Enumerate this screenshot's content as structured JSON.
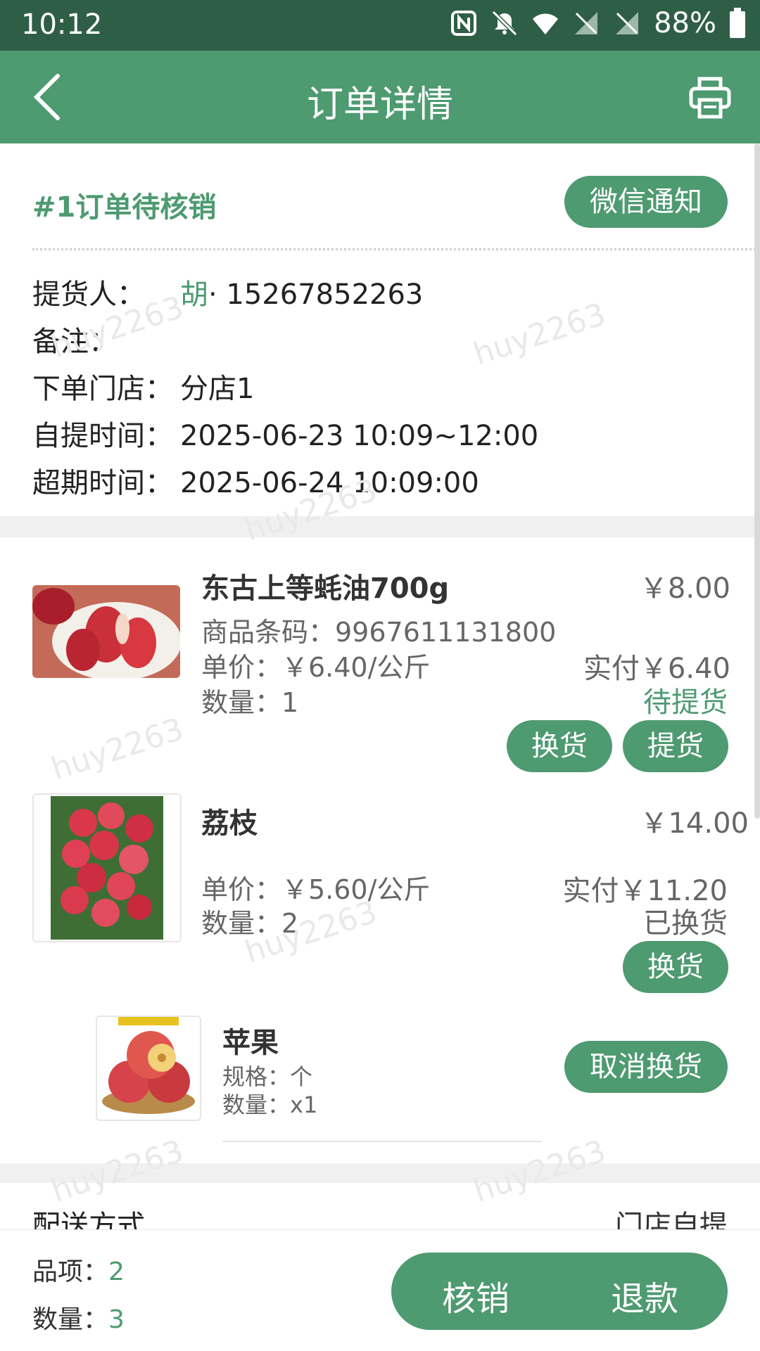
{
  "status_bar": {
    "time": "10:12",
    "battery": "88%"
  },
  "header": {
    "title": "订单详情"
  },
  "order": {
    "status_title": "#1订单待核销",
    "wechat_button": "微信通知",
    "fields": {
      "pickup_label": "提货人：",
      "pickup_name": "胡",
      "pickup_phone": "· 15267852263",
      "note_label": "备注：",
      "store_label": "下单门店：",
      "store_value": "分店1",
      "pickup_time_label": "自提时间：",
      "pickup_time_value": "2025-06-23 10:09~12:00",
      "expire_label": "超期时间：",
      "expire_value": "2025-06-24 10:09:00"
    }
  },
  "products": [
    {
      "name": "东古上等蚝油700g",
      "price": "￥8.00",
      "barcode": "商品条码：9967611131800",
      "unit_price": "单价：￥6.40/公斤",
      "paid": "实付￥6.40",
      "quantity": "数量：1",
      "status": "待提货",
      "btn_exchange": "换货",
      "btn_pickup": "提货"
    },
    {
      "name": "荔枝",
      "price": "￥14.00",
      "unit_price": "单价：￥5.60/公斤",
      "paid": "实付￥11.20",
      "quantity": "数量：2",
      "status": "已换货",
      "btn_exchange": "换货"
    }
  ],
  "exchange_item": {
    "name": "苹果",
    "spec": "规格：个",
    "quantity": "数量：x1",
    "cancel_button": "取消换货"
  },
  "delivery": {
    "label": "配送方式",
    "value": "门店自提"
  },
  "footer": {
    "items_label": "品项：",
    "items_value": "2",
    "qty_label": "数量：",
    "qty_value": "3",
    "verify_button": "核销",
    "refund_button": "退款"
  },
  "watermark_text": "huy2263",
  "colors": {
    "primary": "#4e9a71",
    "statusbar": "#2f5e47"
  }
}
